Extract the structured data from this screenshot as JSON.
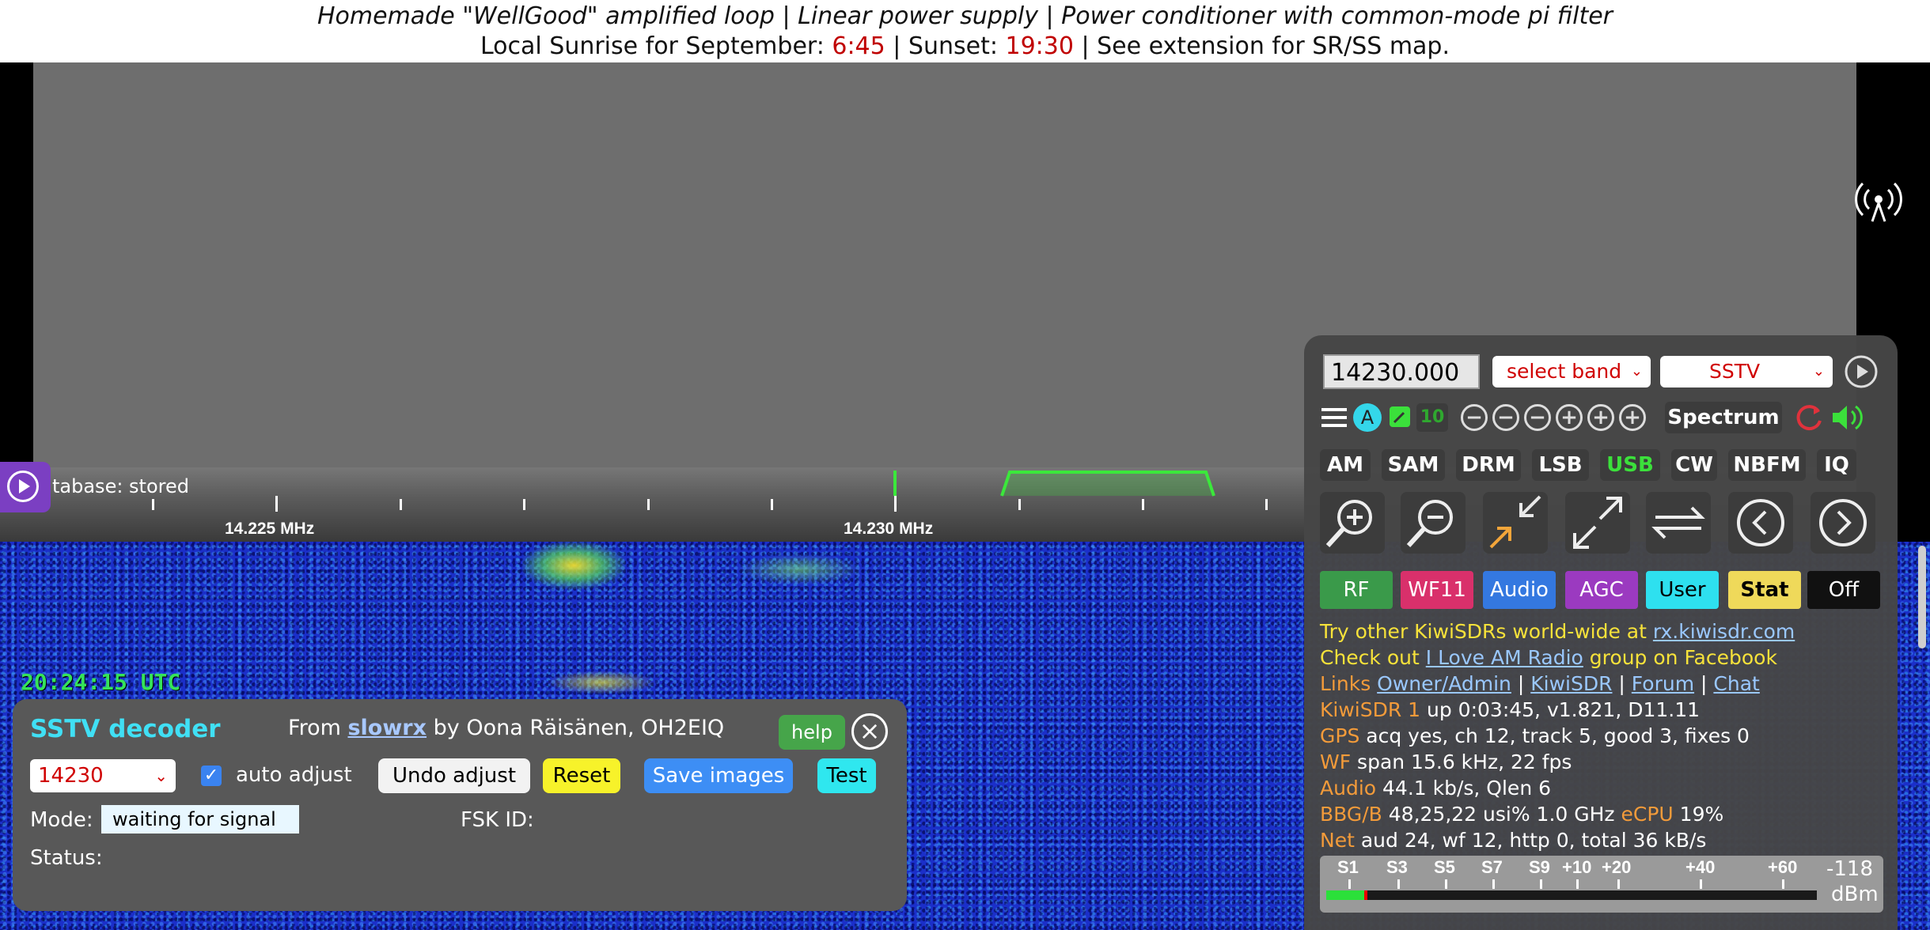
{
  "header": {
    "line1": "Homemade \"WellGood\" amplified loop | Linear power supply | Power conditioner with common-mode pi filter",
    "line2_prefix": "Local Sunrise for September: ",
    "sunrise": "6:45",
    "line2_mid": " | Sunset: ",
    "sunset": "19:30",
    "line2_suffix": " | See extension for SR/SS map."
  },
  "spectrum": {
    "database_status": "tabase: stored",
    "scale_labels": [
      "14.225 MHz",
      "14.230 MHz"
    ]
  },
  "waterfall": {
    "utc_clock": "20:24:15 UTC"
  },
  "sstv": {
    "title": "SSTV decoder",
    "from_prefix": "From ",
    "from_link": "slowrx",
    "from_suffix": " by Oona Räisänen, OH2EIQ",
    "help": "help",
    "close": "×",
    "freq_selected": "14230",
    "auto_adjust_label": "auto adjust",
    "auto_adjust_checked": true,
    "undo_label": "Undo adjust",
    "reset_label": "Reset",
    "save_label": "Save images",
    "test_label": "Test",
    "mode_label": "Mode:",
    "mode_value": "waiting for signal",
    "fsk_label": "FSK ID:",
    "status_label": "Status:"
  },
  "control": {
    "frequency": "14230.000",
    "band_select": "select band",
    "ext_select": "SSTV",
    "step_label": "10",
    "a_label": "A",
    "spectrum_label": "Spectrum",
    "modes": [
      "AM",
      "SAM",
      "DRM",
      "LSB",
      "USB",
      "CW",
      "NBFM",
      "IQ"
    ],
    "active_mode": "USB",
    "tabs": [
      {
        "label": "RF",
        "bg": "#3a9a4a",
        "fg": "#ffffff"
      },
      {
        "label": "WF11",
        "bg": "#d9306b",
        "fg": "#ffffff"
      },
      {
        "label": "Audio",
        "bg": "#3478e0",
        "fg": "#ffffff"
      },
      {
        "label": "AGC",
        "bg": "#9b3ac0",
        "fg": "#ffffff"
      },
      {
        "label": "User",
        "bg": "#2ee0ef",
        "fg": "#000000"
      },
      {
        "label": "Stat",
        "bg": "#efd95a",
        "fg": "#000000"
      },
      {
        "label": "Off",
        "bg": "#111111",
        "fg": "#ffffff"
      }
    ],
    "info": {
      "try_prefix": "Try other KiwiSDRs world-wide at ",
      "try_link": "rx.kiwisdr.com",
      "check_prefix": "Check out ",
      "check_link": "I Love AM Radio",
      "check_suffix": " group on Facebook",
      "links_label": "Links ",
      "links": [
        "Owner/Admin",
        "KiwiSDR",
        "Forum",
        "Chat"
      ],
      "kiwi_label": "KiwiSDR 1",
      "kiwi_value": " up 0:03:45, v1.821, D11.11",
      "gps_label": "GPS",
      "gps_value": " acq yes, ch 12, track 5, good 3, fixes 0",
      "wf_label": "WF",
      "wf_value": " span 15.6 kHz, 22 fps",
      "audio_label": "Audio",
      "audio_value": " 44.1 kb/s, Qlen 6",
      "bbg_label": "BBG/B",
      "bbg_value": " 48,25,22 usi% 1.0 GHz ",
      "ecpu_label": "eCPU",
      "ecpu_value": " 19%",
      "net_label": "Net",
      "net_value": " aud 24, wf 12, http 0, total 36 kB/s"
    },
    "smeter": {
      "labels": [
        "S1",
        "S3",
        "S5",
        "S7",
        "S9",
        "+10",
        "+20",
        "+40",
        "+60"
      ],
      "dbm_value": "-118",
      "dbm_unit": "dBm"
    }
  }
}
